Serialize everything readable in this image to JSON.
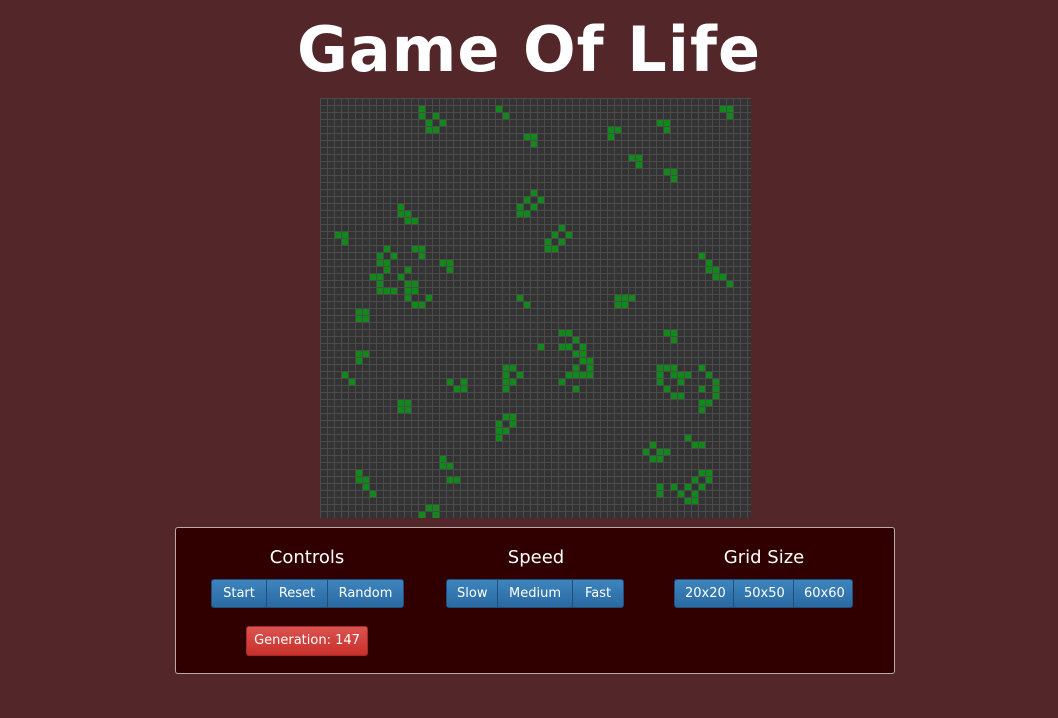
{
  "header": {
    "title": "Game Of Life"
  },
  "board": {
    "rows": 60,
    "cols": 60,
    "cell_color": "#0f8a1a",
    "live_cells": [
      [
        1,
        14
      ],
      [
        1,
        25
      ],
      [
        1,
        57
      ],
      [
        1,
        58
      ],
      [
        2,
        14
      ],
      [
        2,
        16
      ],
      [
        2,
        26
      ],
      [
        2,
        58
      ],
      [
        3,
        15
      ],
      [
        3,
        17
      ],
      [
        3,
        48
      ],
      [
        3,
        49
      ],
      [
        4,
        15
      ],
      [
        4,
        16
      ],
      [
        4,
        41
      ],
      [
        4,
        42
      ],
      [
        4,
        49
      ],
      [
        5,
        29
      ],
      [
        5,
        30
      ],
      [
        5,
        41
      ],
      [
        6,
        30
      ],
      [
        8,
        44
      ],
      [
        8,
        45
      ],
      [
        9,
        45
      ],
      [
        10,
        49
      ],
      [
        10,
        50
      ],
      [
        11,
        50
      ],
      [
        13,
        30
      ],
      [
        14,
        29
      ],
      [
        14,
        31
      ],
      [
        15,
        11
      ],
      [
        15,
        28
      ],
      [
        15,
        30
      ],
      [
        16,
        11
      ],
      [
        16,
        12
      ],
      [
        16,
        28
      ],
      [
        16,
        29
      ],
      [
        17,
        12
      ],
      [
        17,
        13
      ],
      [
        18,
        34
      ],
      [
        19,
        2
      ],
      [
        19,
        3
      ],
      [
        19,
        33
      ],
      [
        19,
        35
      ],
      [
        20,
        3
      ],
      [
        20,
        32
      ],
      [
        20,
        34
      ],
      [
        21,
        9
      ],
      [
        21,
        13
      ],
      [
        21,
        14
      ],
      [
        21,
        32
      ],
      [
        21,
        33
      ],
      [
        22,
        8
      ],
      [
        22,
        10
      ],
      [
        22,
        14
      ],
      [
        22,
        54
      ],
      [
        23,
        8
      ],
      [
        23,
        9
      ],
      [
        23,
        17
      ],
      [
        23,
        18
      ],
      [
        23,
        55
      ],
      [
        24,
        9
      ],
      [
        24,
        12
      ],
      [
        24,
        18
      ],
      [
        24,
        55
      ],
      [
        24,
        56
      ],
      [
        25,
        7
      ],
      [
        25,
        8
      ],
      [
        25,
        11
      ],
      [
        25,
        56
      ],
      [
        25,
        57
      ],
      [
        26,
        8
      ],
      [
        26,
        12
      ],
      [
        26,
        13
      ],
      [
        26,
        58
      ],
      [
        27,
        8
      ],
      [
        27,
        9
      ],
      [
        27,
        10
      ],
      [
        27,
        12
      ],
      [
        27,
        13
      ],
      [
        28,
        12
      ],
      [
        28,
        15
      ],
      [
        28,
        28
      ],
      [
        28,
        42
      ],
      [
        28,
        43
      ],
      [
        28,
        44
      ],
      [
        29,
        13
      ],
      [
        29,
        14
      ],
      [
        29,
        29
      ],
      [
        29,
        42
      ],
      [
        29,
        43
      ],
      [
        30,
        5
      ],
      [
        30,
        6
      ],
      [
        31,
        5
      ],
      [
        31,
        6
      ],
      [
        33,
        34
      ],
      [
        33,
        35
      ],
      [
        33,
        49
      ],
      [
        33,
        50
      ],
      [
        34,
        36
      ],
      [
        34,
        50
      ],
      [
        35,
        31
      ],
      [
        35,
        34
      ],
      [
        35,
        35
      ],
      [
        35,
        37
      ],
      [
        36,
        5
      ],
      [
        36,
        6
      ],
      [
        36,
        36
      ],
      [
        36,
        37
      ],
      [
        37,
        5
      ],
      [
        37,
        37
      ],
      [
        37,
        38
      ],
      [
        38,
        26
      ],
      [
        38,
        27
      ],
      [
        38,
        36
      ],
      [
        38,
        38
      ],
      [
        38,
        48
      ],
      [
        38,
        49
      ],
      [
        38,
        50
      ],
      [
        38,
        54
      ],
      [
        39,
        3
      ],
      [
        39,
        26
      ],
      [
        39,
        28
      ],
      [
        39,
        35
      ],
      [
        39,
        36
      ],
      [
        39,
        37
      ],
      [
        39,
        38
      ],
      [
        39,
        48
      ],
      [
        39,
        50
      ],
      [
        39,
        51
      ],
      [
        39,
        52
      ],
      [
        39,
        55
      ],
      [
        40,
        4
      ],
      [
        40,
        18
      ],
      [
        40,
        20
      ],
      [
        40,
        26
      ],
      [
        40,
        27
      ],
      [
        40,
        34
      ],
      [
        40,
        48
      ],
      [
        40,
        51
      ],
      [
        40,
        56
      ],
      [
        41,
        19
      ],
      [
        41,
        20
      ],
      [
        41,
        26
      ],
      [
        41,
        36
      ],
      [
        41,
        49
      ],
      [
        41,
        54
      ],
      [
        41,
        56
      ],
      [
        42,
        50
      ],
      [
        42,
        51
      ],
      [
        42,
        56
      ],
      [
        43,
        11
      ],
      [
        43,
        12
      ],
      [
        43,
        54
      ],
      [
        43,
        55
      ],
      [
        44,
        11
      ],
      [
        44,
        12
      ],
      [
        44,
        54
      ],
      [
        45,
        26
      ],
      [
        45,
        27
      ],
      [
        46,
        25
      ],
      [
        46,
        27
      ],
      [
        47,
        25
      ],
      [
        47,
        26
      ],
      [
        48,
        25
      ],
      [
        48,
        52
      ],
      [
        49,
        47
      ],
      [
        49,
        53
      ],
      [
        49,
        54
      ],
      [
        50,
        46
      ],
      [
        50,
        48
      ],
      [
        50,
        49
      ],
      [
        51,
        17
      ],
      [
        51,
        47
      ],
      [
        51,
        48
      ],
      [
        52,
        17
      ],
      [
        52,
        18
      ],
      [
        53,
        5
      ],
      [
        53,
        54
      ],
      [
        53,
        55
      ],
      [
        54,
        5
      ],
      [
        54,
        6
      ],
      [
        54,
        18
      ],
      [
        54,
        19
      ],
      [
        54,
        53
      ],
      [
        54,
        55
      ],
      [
        55,
        6
      ],
      [
        55,
        48
      ],
      [
        55,
        50
      ],
      [
        55,
        52
      ],
      [
        55,
        54
      ],
      [
        56,
        7
      ],
      [
        56,
        48
      ],
      [
        56,
        51
      ],
      [
        56,
        53
      ],
      [
        57,
        52
      ],
      [
        57,
        53
      ],
      [
        58,
        15
      ],
      [
        58,
        16
      ],
      [
        59,
        14
      ],
      [
        59,
        16
      ]
    ]
  },
  "controls": {
    "title": "Controls",
    "start_label": "Start",
    "reset_label": "Reset",
    "random_label": "Random",
    "generation_label": "Generation: 147"
  },
  "speed": {
    "title": "Speed",
    "slow_label": "Slow",
    "medium_label": "Medium",
    "fast_label": "Fast"
  },
  "grid_size": {
    "title": "Grid Size",
    "small_label": "20x20",
    "medium_label": "50x50",
    "large_label": "60x60"
  },
  "colors": {
    "background": "#53262a",
    "panel": "#300000",
    "button": "#2b6aa3",
    "generation_badge": "#c9302c",
    "live_cell": "#0f8a1a"
  }
}
